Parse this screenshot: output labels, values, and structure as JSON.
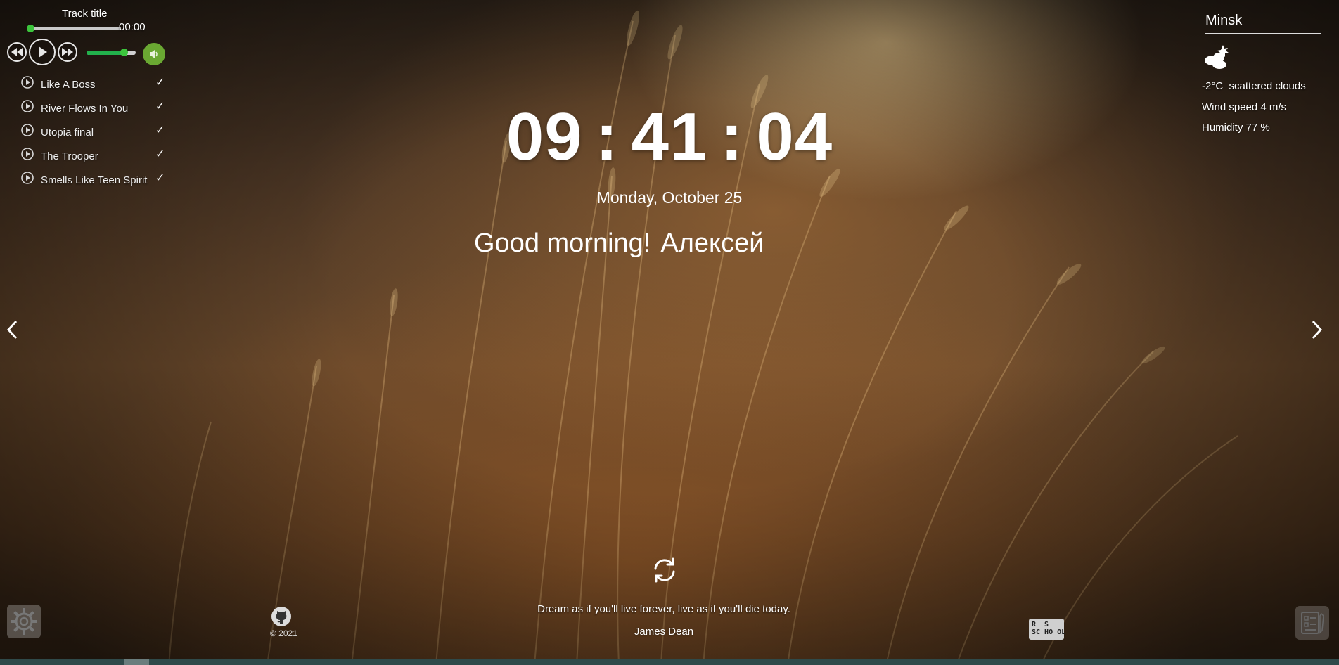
{
  "player": {
    "track_title": "Track title",
    "time": "00:00",
    "progress": 0,
    "volume": 0.75,
    "prev_icon": "rewind-icon",
    "play_icon": "play-icon",
    "next_icon": "fast-forward-icon",
    "mute_icon": "speaker-icon",
    "playlist": [
      {
        "label": "Like A Boss",
        "check": "✓"
      },
      {
        "label": "River Flows In You",
        "check": "✓"
      },
      {
        "label": "Utopia final",
        "check": "✓"
      },
      {
        "label": "The Trooper",
        "check": "✓"
      },
      {
        "label": "Smells Like Teen Spirit",
        "check": "✓"
      }
    ]
  },
  "clock": {
    "hours": "09",
    "minutes": "41",
    "seconds": "04",
    "separator": ":"
  },
  "date": "Monday, October 25",
  "greeting": {
    "text": "Good morning!",
    "name": "Алексей"
  },
  "weather": {
    "city": "Minsk",
    "icon": "cloudy-night-icon",
    "temperature": "-2°C",
    "description": "scattered clouds",
    "wind": "Wind speed 4 m/s",
    "humidity": "Humidity 77 %"
  },
  "quote": {
    "text": "Dream as if you'll live forever, live as if you'll die today.",
    "author": "James Dean"
  },
  "footer": {
    "copyright": "© 2021",
    "rs_logo_text": "RS SCHOOL"
  },
  "colors": {
    "accent_green": "#3cc43c",
    "mute_button": "#6aa832"
  }
}
